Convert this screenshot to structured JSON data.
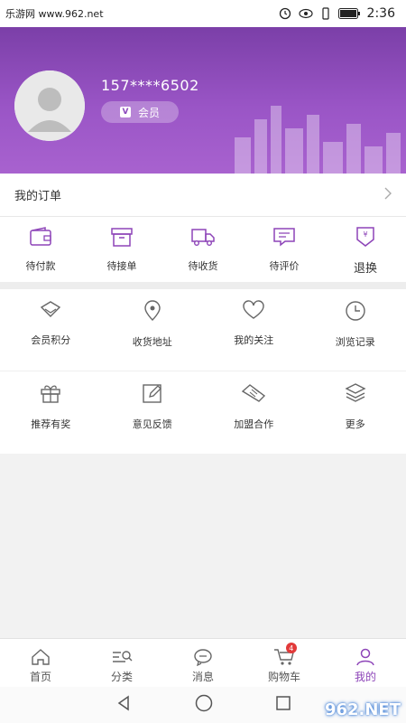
{
  "status_bar": {
    "left_text": "乐游网 www.962.net",
    "time": "2:36"
  },
  "profile": {
    "phone": "157****6502",
    "badge_label": "会员"
  },
  "orders": {
    "title": "我的订单",
    "tabs": [
      {
        "label": "待付款",
        "icon": "wallet-icon"
      },
      {
        "label": "待接单",
        "icon": "box-icon"
      },
      {
        "label": "待收货",
        "icon": "truck-icon"
      },
      {
        "label": "待评价",
        "icon": "comment-icon"
      },
      {
        "label": "退换",
        "icon": "refund-icon"
      }
    ]
  },
  "grid": {
    "row1": [
      {
        "label": "会员积分",
        "icon": "diamond-icon"
      },
      {
        "label": "收货地址",
        "icon": "location-icon"
      },
      {
        "label": "我的关注",
        "icon": "heart-icon"
      },
      {
        "label": "浏览记录",
        "icon": "clock-icon"
      }
    ],
    "row2": [
      {
        "label": "推荐有奖",
        "icon": "gift-icon"
      },
      {
        "label": "意见反馈",
        "icon": "edit-icon"
      },
      {
        "label": "加盟合作",
        "icon": "handshake-icon"
      },
      {
        "label": "更多",
        "icon": "layers-icon"
      }
    ]
  },
  "bottom_nav": {
    "items": [
      {
        "label": "首页",
        "icon": "home-icon"
      },
      {
        "label": "分类",
        "icon": "category-icon"
      },
      {
        "label": "消息",
        "icon": "message-icon"
      },
      {
        "label": "购物车",
        "icon": "cart-icon",
        "badge": "4"
      },
      {
        "label": "我的",
        "icon": "user-icon"
      }
    ]
  },
  "watermark": "962.NET",
  "colors": {
    "accent": "#8d44b8",
    "header_top": "#7b3fa8",
    "header_bottom": "#a862cf",
    "badge_red": "#e23a3a"
  }
}
